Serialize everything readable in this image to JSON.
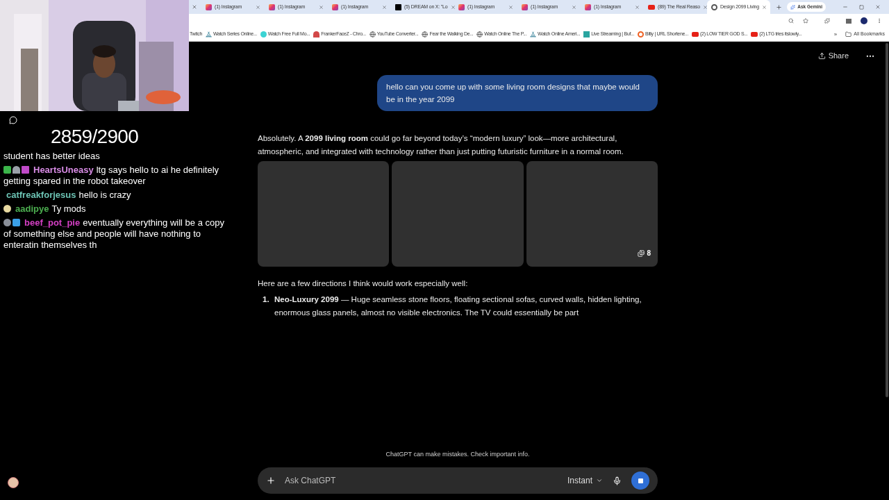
{
  "stream_overlay": {
    "counter": "2859/2900",
    "chat": [
      {
        "text": "student has better ideas"
      },
      {
        "user": "HeartsUneasy",
        "color": "#d98ce6",
        "badges": [
          {
            "kind": "pencil"
          },
          {
            "kind": "robot"
          },
          {
            "kind": "gift"
          }
        ],
        "text": "ltg says hello to ai he definitely getting spared in the robot takeover"
      },
      {
        "user": "catfreakforjesus",
        "color": "#6cc3b4",
        "text": "hello is crazy"
      },
      {
        "user": "aadipye",
        "color": "#4caf50",
        "badges": [
          {
            "kind": "figure"
          }
        ],
        "text": "Ty mods"
      },
      {
        "user": "beef_pot_pie",
        "color": "#d43fc4",
        "badges": [
          {
            "kind": "medal"
          },
          {
            "kind": "crown"
          }
        ],
        "text": "eventually everything will be a copy of something else and people will have nothing to enteratin themselves th"
      }
    ]
  },
  "browser": {
    "tabs": [
      {
        "kind": "instagram",
        "title": "(1) Instagram",
        "selected": false
      },
      {
        "kind": "instagram",
        "title": "(1) Instagram",
        "selected": false
      },
      {
        "kind": "instagram",
        "title": "(1) Instagram",
        "selected": false
      },
      {
        "kind": "x",
        "title": "(5) DREAM on X: \"Lo",
        "selected": false
      },
      {
        "kind": "instagram",
        "title": "(1) Instagram",
        "selected": false
      },
      {
        "kind": "instagram",
        "title": "(1) Instagram",
        "selected": false
      },
      {
        "kind": "instagram",
        "title": "(1) Instagram",
        "selected": false
      },
      {
        "kind": "youtube",
        "title": "(89) The Real Reaso",
        "selected": false
      },
      {
        "kind": "chat",
        "title": "Design 2099 Living",
        "selected": true
      }
    ],
    "gemini_button": "Ask Gemini",
    "bookmarks": [
      {
        "kind": "none",
        "title": "Twitch"
      },
      {
        "kind": "tent",
        "title": "Watch Series Online..."
      },
      {
        "kind": "dot",
        "title": "Watch Free Full Mo..."
      },
      {
        "kind": "ffz",
        "title": "FrankerFaceZ - Chro..."
      },
      {
        "kind": "globe",
        "title": "YouTube Converter..."
      },
      {
        "kind": "globe",
        "title": "Fear the Walking De..."
      },
      {
        "kind": "globe",
        "title": "Watch Online The P..."
      },
      {
        "kind": "tent",
        "title": "Watch Online Ameri..."
      },
      {
        "kind": "stream",
        "title": "Live Streaming | Buf..."
      },
      {
        "kind": "bitly",
        "title": "Bitly | URL Shortene..."
      },
      {
        "kind": "youtube",
        "title": "(2) LOW TIER GOD S..."
      },
      {
        "kind": "youtube",
        "title": "(2) LTG tries itslowly..."
      }
    ],
    "more_bookmarks": "»",
    "all_bookmarks": "All Bookmarks"
  },
  "chat_page": {
    "share": "Share",
    "user_message": "hello can you come up with some living room designs that maybe would be in the year 2099",
    "intro": "Absolutely. A **2099 living room** could go far beyond today’s “modern luxury” look—more architectural, atmospheric, and integrated with technology rather than just putting futuristic furniture in a normal room.",
    "image_count": "8",
    "lead": "Here are a few directions I think would work especially well:",
    "list": [
      {
        "number": "1.",
        "title": "Neo-Luxury 2099",
        "text": "— Huge seamless stone floors, floating sectional sofas, curved walls, hidden lighting, enormous glass panels, almost no visible electronics. The TV could essentially be part"
      }
    ],
    "disclaimer": "ChatGPT can make mistakes. Check important info.",
    "input_placeholder": "Ask ChatGPT",
    "mode": "Instant"
  }
}
